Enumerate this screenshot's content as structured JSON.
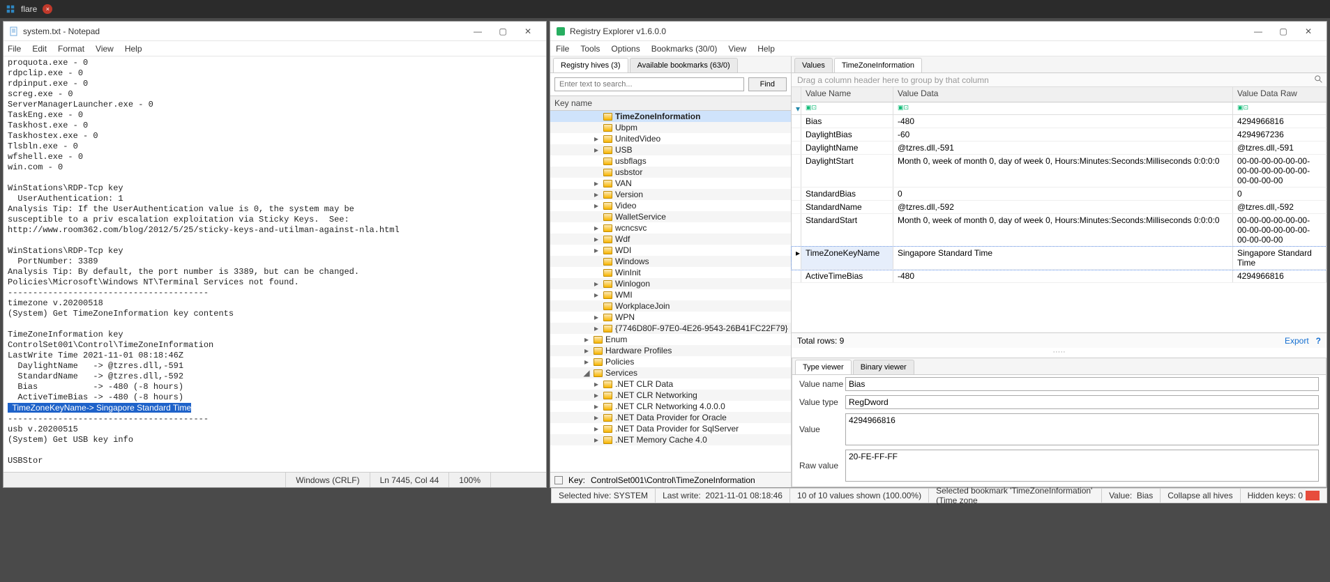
{
  "taskbar": {
    "label": "flare"
  },
  "notepad": {
    "title": "system.txt - Notepad",
    "menus": [
      "File",
      "Edit",
      "Format",
      "View",
      "Help"
    ],
    "lines_before": [
      "proquota.exe - 0",
      "rdpclip.exe - 0",
      "rdpinput.exe - 0",
      "screg.exe - 0",
      "ServerManagerLauncher.exe - 0",
      "TaskEng.exe - 0",
      "Taskhost.exe - 0",
      "Taskhostex.exe - 0",
      "Tlsbln.exe - 0",
      "wfshell.exe - 0",
      "win.com - 0",
      "",
      "WinStations\\RDP-Tcp key",
      "  UserAuthentication: 1",
      "Analysis Tip: If the UserAuthentication value is 0, the system may be",
      "susceptible to a priv escalation exploitation via Sticky Keys.  See:",
      "http://www.room362.com/blog/2012/5/25/sticky-keys-and-utilman-against-nla.html",
      "",
      "WinStations\\RDP-Tcp key",
      "  PortNumber: 3389",
      "Analysis Tip: By default, the port number is 3389, but can be changed.",
      "Policies\\Microsoft\\Windows NT\\Terminal Services not found.",
      "----------------------------------------",
      "timezone v.20200518",
      "(System) Get TimeZoneInformation key contents",
      "",
      "TimeZoneInformation key",
      "ControlSet001\\Control\\TimeZoneInformation",
      "LastWrite Time 2021-11-01 08:18:46Z",
      "  DaylightName   -> @tzres.dll,-591",
      "  StandardName   -> @tzres.dll,-592",
      "  Bias           -> -480 (-8 hours)",
      "  ActiveTimeBias -> -480 (-8 hours)"
    ],
    "highlight": "  TimeZoneKeyName-> Singapore Standard Time",
    "lines_after": [
      "----------------------------------------",
      "usb v.20200515",
      "(System) Get USB key info",
      "",
      "USBStor"
    ],
    "status": {
      "encoding": "Windows (CRLF)",
      "pos": "Ln 7445, Col 44",
      "zoom": "100%"
    }
  },
  "regexp": {
    "title": "Registry Explorer v1.6.0.0",
    "menus": [
      "File",
      "Tools",
      "Options",
      "Bookmarks (30/0)",
      "View",
      "Help"
    ],
    "left_tabs": [
      "Registry hives (3)",
      "Available bookmarks (63/0)"
    ],
    "search_placeholder": "Enter text to search...",
    "find_label": "Find",
    "keycol": "Key name",
    "tree": [
      {
        "label": "TimeZoneInformation",
        "sel": true,
        "indent": 0
      },
      {
        "label": "Ubpm",
        "indent": 0
      },
      {
        "label": "UnitedVideo",
        "indent": 0,
        "arrow": true
      },
      {
        "label": "USB",
        "indent": 0,
        "arrow": true
      },
      {
        "label": "usbflags",
        "indent": 0
      },
      {
        "label": "usbstor",
        "indent": 0
      },
      {
        "label": "VAN",
        "indent": 0,
        "arrow": true
      },
      {
        "label": "Version",
        "indent": 0,
        "arrow": true
      },
      {
        "label": "Video",
        "indent": 0,
        "arrow": true
      },
      {
        "label": "WalletService",
        "indent": 0
      },
      {
        "label": "wcncsvc",
        "indent": 0,
        "arrow": true
      },
      {
        "label": "Wdf",
        "indent": 0,
        "arrow": true
      },
      {
        "label": "WDI",
        "indent": 0,
        "arrow": true
      },
      {
        "label": "Windows",
        "indent": 0
      },
      {
        "label": "WinInit",
        "indent": 0
      },
      {
        "label": "Winlogon",
        "indent": 0,
        "arrow": true
      },
      {
        "label": "WMI",
        "indent": 0,
        "arrow": true
      },
      {
        "label": "WorkplaceJoin",
        "indent": 0
      },
      {
        "label": "WPN",
        "indent": 0,
        "arrow": true
      },
      {
        "label": "{7746D80F-97E0-4E26-9543-26B41FC22F79}",
        "indent": 0,
        "arrow": true
      },
      {
        "label": "Enum",
        "indent": -1,
        "arrow": true
      },
      {
        "label": "Hardware Profiles",
        "indent": -1,
        "arrow": true
      },
      {
        "label": "Policies",
        "indent": -1,
        "arrow": true
      },
      {
        "label": "Services",
        "indent": -1,
        "arrow": true,
        "open": true
      },
      {
        "label": ".NET CLR Data",
        "indent": 0,
        "arrow": true
      },
      {
        "label": ".NET CLR Networking",
        "indent": 0,
        "arrow": true
      },
      {
        "label": ".NET CLR Networking 4.0.0.0",
        "indent": 0,
        "arrow": true
      },
      {
        "label": ".NET Data Provider for Oracle",
        "indent": 0,
        "arrow": true
      },
      {
        "label": ".NET Data Provider for SqlServer",
        "indent": 0,
        "arrow": true
      },
      {
        "label": ".NET Memory Cache 4.0",
        "indent": 0,
        "arrow": true
      }
    ],
    "left_status": {
      "key_label": "Key:",
      "key_path": "ControlSet001\\Control\\TimeZoneInformation"
    },
    "right_tabs": [
      "Values",
      "TimeZoneInformation"
    ],
    "group_hint": "Drag a column header here to group by that column",
    "valcols": [
      "Value Name",
      "Value Data",
      "Value Data Raw"
    ],
    "values": [
      {
        "n": "Bias",
        "d": "-480",
        "r": "4294966816"
      },
      {
        "n": "DaylightBias",
        "d": "-60",
        "r": "4294967236"
      },
      {
        "n": "DaylightName",
        "d": "@tzres.dll,-591",
        "r": "@tzres.dll,-591"
      },
      {
        "n": "DaylightStart",
        "d": "Month 0, week of month 0, day of week 0, Hours:Minutes:Seconds:Milliseconds 0:0:0:0",
        "r": "00-00-00-00-00-00-00-00-00-00-00-00-00-00-00-00"
      },
      {
        "n": "StandardBias",
        "d": "0",
        "r": "0"
      },
      {
        "n": "StandardName",
        "d": "@tzres.dll,-592",
        "r": "@tzres.dll,-592"
      },
      {
        "n": "StandardStart",
        "d": "Month 0, week of month 0, day of week 0, Hours:Minutes:Seconds:Milliseconds 0:0:0:0",
        "r": "00-00-00-00-00-00-00-00-00-00-00-00-00-00-00-00"
      },
      {
        "n": "TimeZoneKeyName",
        "d": "Singapore Standard Time",
        "r": "Singapore Standard Time",
        "sel": true
      },
      {
        "n": "ActiveTimeBias",
        "d": "-480",
        "r": "4294966816"
      }
    ],
    "total_rows": "Total rows: 9",
    "export": "Export",
    "viewer_tabs": [
      "Type viewer",
      "Binary viewer"
    ],
    "viewer": {
      "name_lbl": "Value name",
      "name_val": "Bias",
      "type_lbl": "Value type",
      "type_val": "RegDword",
      "val_lbl": "Value",
      "val_val": "4294966816",
      "raw_lbl": "Raw value",
      "raw_val": "20-FE-FF-FF"
    }
  },
  "bottom_status": {
    "selected_hive": "Selected hive: SYSTEM",
    "last_write_lbl": "Last write:",
    "last_write": "2021-11-01 08:18:46",
    "shown": "10 of 10 values shown (100.00%)",
    "bookmark": "Selected bookmark 'TimeZoneInformation' (Time zone",
    "value_lbl": "Value:",
    "value": "Bias",
    "collapse": "Collapse all hives",
    "hidden": "Hidden keys: 0"
  }
}
